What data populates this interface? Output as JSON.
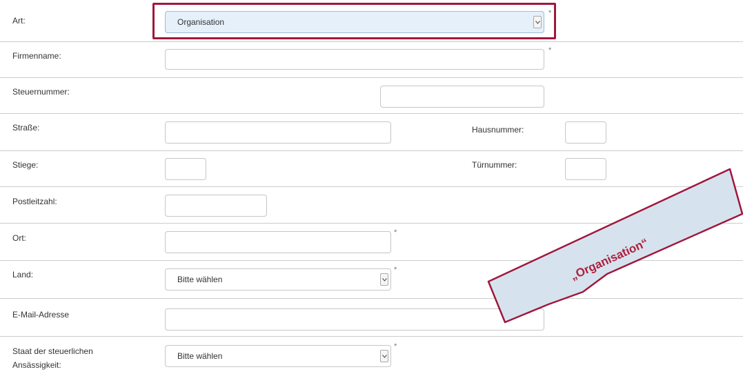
{
  "form": {
    "art": {
      "label": "Art:",
      "value": "Organisation",
      "required": "*"
    },
    "firmenname": {
      "label": "Firmenname:",
      "required": "*"
    },
    "steuernummer": {
      "label": "Steuernummer:"
    },
    "strasse": {
      "label": "Straße:"
    },
    "hausnummer": {
      "label": "Hausnummer:"
    },
    "stiege": {
      "label": "Stiege:"
    },
    "tuernummer": {
      "label": "Türnummer:"
    },
    "postleitzahl": {
      "label": "Postleitzahl:"
    },
    "ort": {
      "label": "Ort:",
      "required": "*"
    },
    "land": {
      "label": "Land:",
      "value": "Bitte wählen",
      "required": "*"
    },
    "email": {
      "label": "E-Mail-Adresse"
    },
    "staat": {
      "label_line1": "Staat der steuerlichen",
      "label_line2": "Ansässigkeit:",
      "value": "Bitte wählen",
      "required": "*"
    }
  },
  "annotation": {
    "text": "„Organisation“",
    "color": "#a0173b",
    "fill": "#d6e3ef"
  }
}
